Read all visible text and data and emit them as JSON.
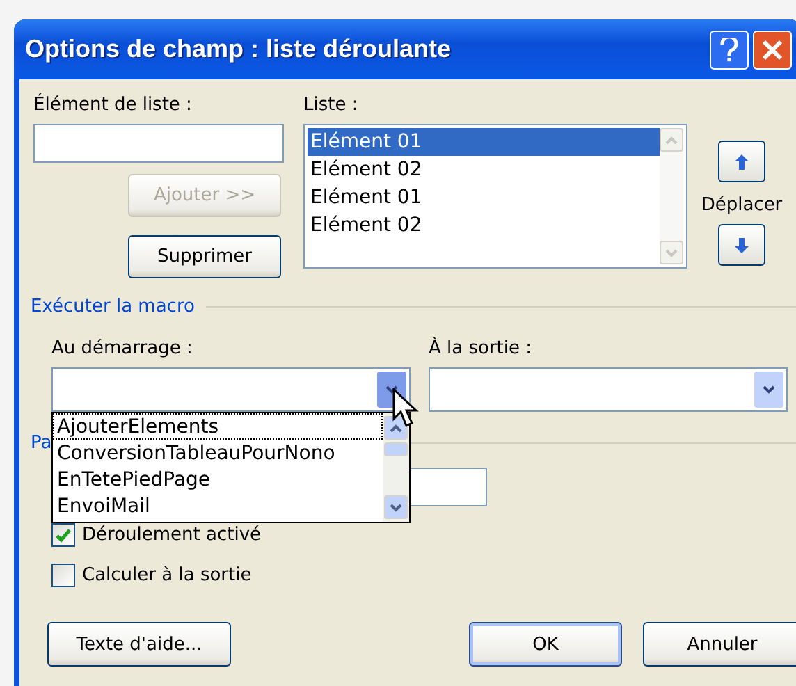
{
  "window": {
    "title": "Options de champ : liste déroulante"
  },
  "item_field": {
    "label": "Élément de liste :"
  },
  "add_button": {
    "label": "Ajouter >>",
    "disabled": true
  },
  "remove_button": {
    "label": "Supprimer",
    "disabled": false
  },
  "list": {
    "label": "Liste :",
    "items": [
      {
        "text": "Elément 01",
        "selected": true
      },
      {
        "text": "Elément 02",
        "selected": false
      },
      {
        "text": "Elément 01",
        "selected": false
      },
      {
        "text": "Elément 02",
        "selected": false
      }
    ]
  },
  "move": {
    "label": "Déplacer"
  },
  "macro_section": {
    "title": "Exécuter la macro",
    "on_entry": {
      "label": "Au démarrage :",
      "open": true
    },
    "on_exit": {
      "label": "À la sortie :"
    }
  },
  "dropdown_options": [
    {
      "text": "AjouterElements",
      "selected": true
    },
    {
      "text": "ConversionTableauPourNono",
      "selected": false
    },
    {
      "text": "EnTetePiedPage",
      "selected": false
    },
    {
      "text": "EnvoiMail",
      "selected": false
    }
  ],
  "field_section": {
    "title": "Pa"
  },
  "checkboxes": [
    {
      "label": "Déroulement activé",
      "checked": true
    },
    {
      "label": "Calculer à la sortie",
      "checked": false
    }
  ],
  "buttons": [
    {
      "label": "Texte d'aide...",
      "kind": "help"
    },
    {
      "label": "OK",
      "kind": "default"
    },
    {
      "label": "Annuler",
      "kind": "normal"
    }
  ]
}
